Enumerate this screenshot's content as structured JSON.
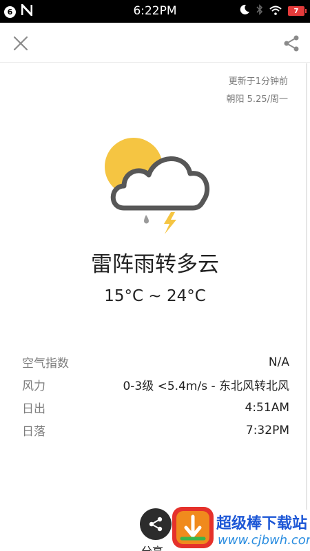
{
  "status_bar": {
    "notification_count": "6",
    "time": "6:22PM",
    "battery_level": "7",
    "icons": [
      "n-app-icon",
      "moon-icon",
      "bluetooth-icon",
      "wifi-icon",
      "battery-icon"
    ]
  },
  "header": {
    "close_icon": "close-icon",
    "share_icon": "share-icon"
  },
  "weather": {
    "updated": "更新于1分钟前",
    "location_date": "朝阳  5.25/周一",
    "icon": "thunderstorm-partly-sunny-icon",
    "condition": "雷阵雨转多云",
    "temp_range": "15°C ~ 24°C",
    "colors": {
      "sun": "#f5c542",
      "cloud_outline": "#555555",
      "bolt": "#f5c542",
      "rain": "#9a9a9a"
    }
  },
  "details": [
    {
      "label": "空气指数",
      "value": "N/A"
    },
    {
      "label": "风力",
      "value": "0-3级 <5.4m/s - 东北风转北风"
    },
    {
      "label": "日出",
      "value": "4:51AM"
    },
    {
      "label": "日落",
      "value": "7:32PM"
    }
  ],
  "bottom": {
    "share_label": "分享"
  },
  "watermark": {
    "title": "超级棒下载站",
    "url": "www.cjbwh.com"
  }
}
